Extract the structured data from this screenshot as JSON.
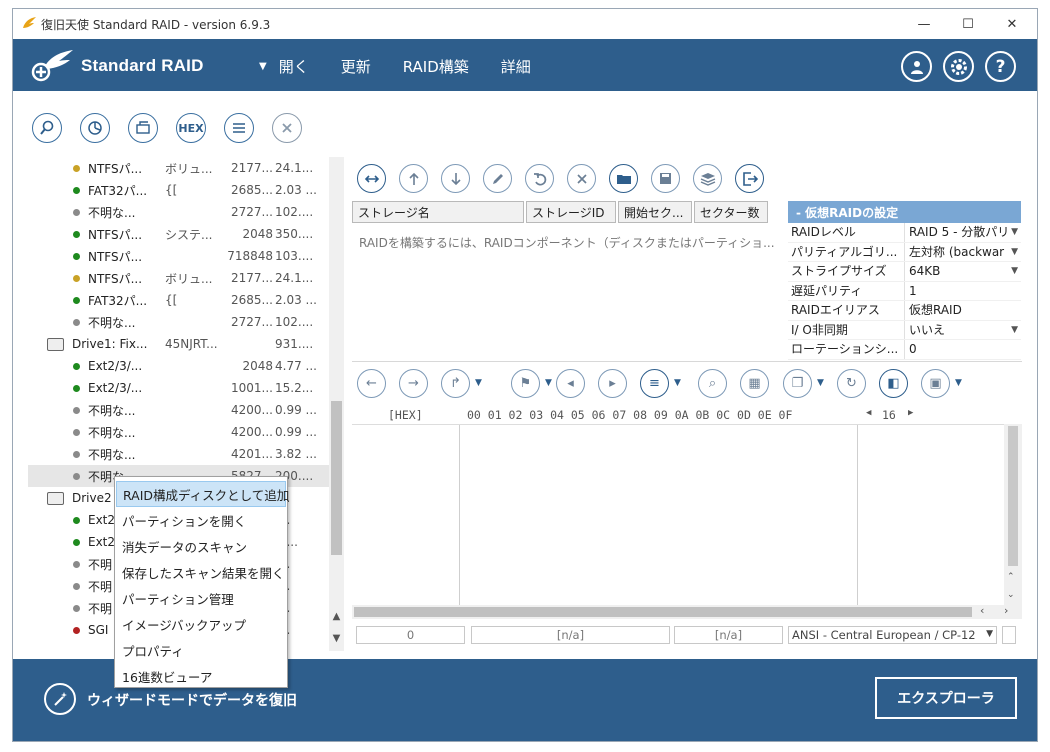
{
  "window": {
    "title": "復旧天使 Standard RAID - version 6.9.3",
    "controls": {
      "minimize": "—",
      "maximize": "☐",
      "close": "✕"
    }
  },
  "header": {
    "app_name": "Standard RAID",
    "menu": [
      "開く",
      "更新",
      "RAID構築",
      "詳細"
    ],
    "right_icons": [
      "user-icon",
      "gear-icon",
      "help-icon"
    ],
    "help_glyph": "?"
  },
  "left_toolbar": {
    "icons": [
      "search-icon",
      "scan-icon",
      "image-icon",
      "hex-icon",
      "list-icon",
      "close-icon"
    ],
    "hex_label": "HEX"
  },
  "tree": {
    "rows": [
      {
        "indent": 1,
        "dot": "#c9a227",
        "name": "NTFSパ...",
        "type": "ボリュ...",
        "start": "2177...",
        "size": "24.1..."
      },
      {
        "indent": 1,
        "dot": "#1e8a1e",
        "name": "FAT32パ...",
        "type": "{[",
        "start": "2685...",
        "size": "2.03 ..."
      },
      {
        "indent": 1,
        "dot": "#8a8a8a",
        "name": "不明な...",
        "type": "",
        "start": "2727...",
        "size": "102...."
      },
      {
        "indent": 1,
        "dot": "#1e8a1e",
        "name": "NTFSパ...",
        "type": "システ...",
        "start": "2048",
        "size": "350...."
      },
      {
        "indent": 1,
        "dot": "#1e8a1e",
        "name": "NTFSパ...",
        "type": "",
        "start": "718848",
        "size": "103...."
      },
      {
        "indent": 1,
        "dot": "#c9a227",
        "name": "NTFSパ...",
        "type": "ボリュ...",
        "start": "2177...",
        "size": "24.1..."
      },
      {
        "indent": 1,
        "dot": "#1e8a1e",
        "name": "FAT32パ...",
        "type": "{[",
        "start": "2685...",
        "size": "2.03 ..."
      },
      {
        "indent": 1,
        "dot": "#8a8a8a",
        "name": "不明な...",
        "type": "",
        "start": "2727...",
        "size": "102...."
      },
      {
        "indent": 0,
        "drive": true,
        "name": "Drive1: Fix...",
        "type": "45NJRT...",
        "start": "",
        "size": "931...."
      },
      {
        "indent": 1,
        "dot": "#1e8a1e",
        "name": "Ext2/3/...",
        "type": "",
        "start": "2048",
        "size": "4.77 ..."
      },
      {
        "indent": 1,
        "dot": "#1e8a1e",
        "name": "Ext2/3/...",
        "type": "",
        "start": "1001...",
        "size": "15.2..."
      },
      {
        "indent": 1,
        "dot": "#8a8a8a",
        "name": "不明な...",
        "type": "",
        "start": "4200...",
        "size": "0.99 ..."
      },
      {
        "indent": 1,
        "dot": "#8a8a8a",
        "name": "不明な...",
        "type": "",
        "start": "4200...",
        "size": "0.99 ..."
      },
      {
        "indent": 1,
        "dot": "#8a8a8a",
        "name": "不明な...",
        "type": "",
        "start": "4201...",
        "size": "3.82 ..."
      },
      {
        "indent": 1,
        "dot": "#8a8a8a",
        "name": "不明な...",
        "type": "",
        "start": "5827...",
        "size": "200....",
        "selected": true
      },
      {
        "indent": 0,
        "drive": true,
        "name": "Drive2",
        "type": "",
        "start": "",
        "size": "...."
      },
      {
        "indent": 1,
        "dot": "#1e8a1e",
        "name": "Ext2",
        "type": "",
        "start": "",
        "size": "...."
      },
      {
        "indent": 1,
        "dot": "#1e8a1e",
        "name": "Ext2",
        "type": "",
        "start": "",
        "size": "2...."
      },
      {
        "indent": 1,
        "dot": "#8a8a8a",
        "name": "不明",
        "type": "",
        "start": "",
        "size": "...."
      },
      {
        "indent": 1,
        "dot": "#8a8a8a",
        "name": "不明",
        "type": "",
        "start": "",
        "size": "...."
      },
      {
        "indent": 1,
        "dot": "#8a8a8a",
        "name": "不明",
        "type": "",
        "start": "",
        "size": "...."
      },
      {
        "indent": 1,
        "dot": "#b22222",
        "name": "SGI",
        "type": "",
        "start": "",
        "size": "...."
      }
    ]
  },
  "context_menu": {
    "items": [
      "RAID構成ディスクとして追加",
      "パーティションを開く",
      "消失データのスキャン",
      "保存したスキャン結果を開く",
      "パーティション管理",
      "イメージバックアップ",
      "プロパティ",
      "16進数ビューア"
    ],
    "highlighted": 0
  },
  "raid_toolbar": {
    "icons": [
      "swap-icon",
      "arrow-up-icon",
      "arrow-down-icon",
      "pencil-icon",
      "undo-icon",
      "remove-icon",
      "folder-open-icon",
      "save-icon",
      "layers-icon",
      "export-icon"
    ]
  },
  "storage": {
    "columns": [
      "ストレージ名",
      "ストレージID",
      "開始セク...",
      "セクター数"
    ],
    "empty_message": "RAIDを構築するには、RAIDコンポーネント（ディスクまたはパーティショ..."
  },
  "raid_settings": {
    "header": "- 仮想RAIDの設定",
    "rows": [
      {
        "key": "RAIDレベル",
        "value": "RAID 5 - 分散パリ",
        "dropdown": true
      },
      {
        "key": "パリティアルゴリ...",
        "value": "左対称 (backwar",
        "dropdown": true
      },
      {
        "key": "ストライプサイズ",
        "value": "64KB",
        "dropdown": true
      },
      {
        "key": "遅延パリティ",
        "value": "1",
        "dropdown": false
      },
      {
        "key": "RAIDエイリアス",
        "value": "仮想RAID",
        "dropdown": false
      },
      {
        "key": "I/ O非同期",
        "value": "いいえ",
        "dropdown": true
      },
      {
        "key": "ローテーションシ...",
        "value": "0",
        "dropdown": false
      }
    ]
  },
  "hex_toolbar": {
    "icons": [
      "back-icon",
      "forward-icon",
      "goto-icon",
      "bookmark-icon",
      "prev-mark-icon",
      "next-mark-icon",
      "list-icon",
      "find-icon",
      "select-block-icon",
      "copy-icon",
      "refresh-icon",
      "panel-icon",
      "save-icon"
    ]
  },
  "hex_viewer": {
    "offset_label": "[HEX]",
    "columns": "00 01 02 03 04 05 06 07 08 09 0A 0B 0C 0D 0E 0F",
    "width_label": "16",
    "width_left": "◀",
    "width_right": "▶"
  },
  "status": {
    "offset": "0",
    "field2": "[n/a]",
    "field3": "[n/a]",
    "encoding": "ANSI - Central European / CP-12"
  },
  "footer": {
    "wizard_label": "ウィザードモードでデータを復旧",
    "explorer_label": "エクスプローラ"
  },
  "colors": {
    "brand": "#2e5e8c",
    "panel_header": "#7aa7d4",
    "menu_highlight": "#cce4f7"
  }
}
